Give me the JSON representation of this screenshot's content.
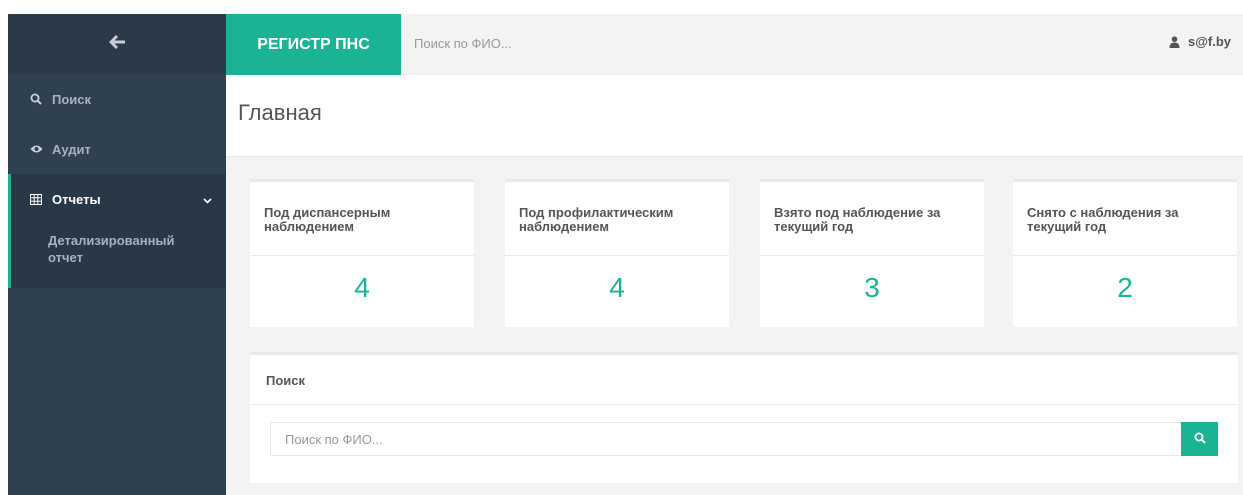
{
  "sidebar": {
    "back_icon": "arrow-left-icon",
    "items": [
      {
        "label": "Поиск",
        "icon": "search-icon"
      },
      {
        "label": "Аудит",
        "icon": "eye-icon"
      },
      {
        "label": "Отчеты",
        "icon": "table-icon",
        "expanded": true,
        "children": [
          {
            "label": "Детализированный отчет"
          }
        ]
      }
    ]
  },
  "topbar": {
    "brand": "РЕГИСТР ПНС",
    "search_placeholder": "Поиск по ФИО...",
    "user": "s@f.by",
    "user_icon": "user-icon"
  },
  "page": {
    "title": "Главная"
  },
  "stats": [
    {
      "title": "Под диспансерным наблюдением",
      "value": "4"
    },
    {
      "title": "Под профилактическим наблюдением",
      "value": "4"
    },
    {
      "title": "Взято под наблюдение за текущий год",
      "value": "3"
    },
    {
      "title": "Снято с наблюдения за текущий год",
      "value": "2"
    }
  ],
  "search_panel": {
    "title": "Поиск",
    "placeholder": "Поиск по ФИО...",
    "button_icon": "search-icon"
  },
  "colors": {
    "accent": "#1ab394",
    "sidebar": "#2f4050"
  }
}
